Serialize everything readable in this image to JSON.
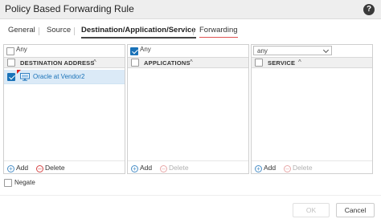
{
  "dialog": {
    "title": "Policy Based Forwarding Rule"
  },
  "tabs": [
    {
      "label": "General"
    },
    {
      "label": "Source"
    },
    {
      "label": "Destination/Application/Service"
    },
    {
      "label": "Forwarding"
    }
  ],
  "destination": {
    "any_label": "Any",
    "header": "DESTINATION ADDRESS",
    "rows": [
      {
        "label": "Oracle at Vendor2"
      }
    ],
    "add_label": "Add",
    "delete_label": "Delete"
  },
  "applications": {
    "any_label": "Any",
    "header": "APPLICATIONS",
    "add_label": "Add",
    "delete_label": "Delete"
  },
  "service": {
    "select_value": "any",
    "header": "SERVICE",
    "add_label": "Add",
    "delete_label": "Delete"
  },
  "negate_label": "Negate",
  "buttons": {
    "ok": "OK",
    "cancel": "Cancel"
  },
  "colors": {
    "accent": "#1a72b8",
    "error_underline": "#e05252",
    "selected_row": "#dbeaf7"
  },
  "icons": {
    "help": "help-icon",
    "sort": "sort-asc-icon",
    "address": "monitor-icon",
    "add": "plus-circle-icon",
    "delete": "minus-circle-icon"
  }
}
